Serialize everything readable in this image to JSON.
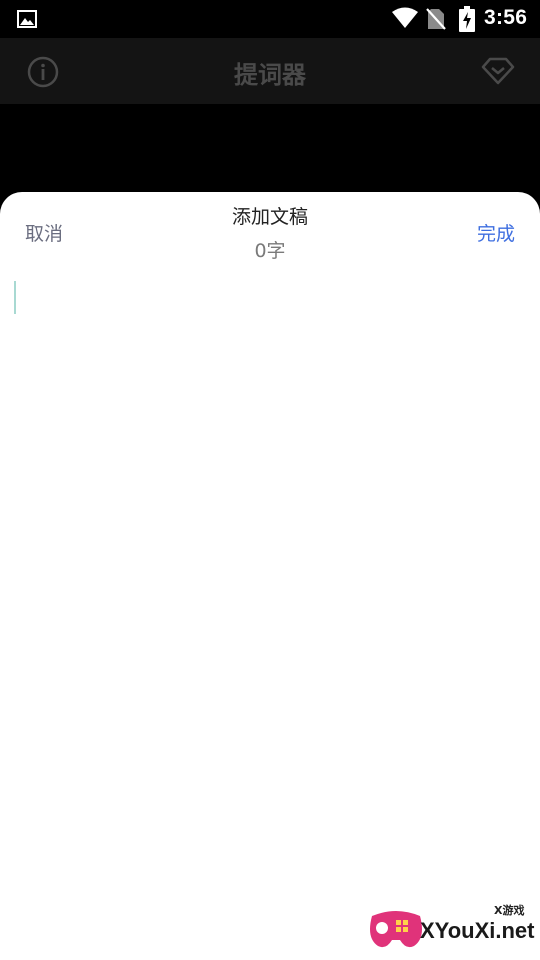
{
  "status_bar": {
    "time": "3:56",
    "icons": [
      "gallery-icon",
      "wifi-icon",
      "no-sim-icon",
      "battery-charging-icon"
    ]
  },
  "app_bar": {
    "title": "提词器",
    "left_icon": "info-icon",
    "right_icon": "diamond-icon"
  },
  "sheet": {
    "title": "添加文稿",
    "word_count": "0字",
    "cancel_label": "取消",
    "done_label": "完成",
    "editor_value": ""
  },
  "watermark": {
    "small_text": "X游戏",
    "text": "XYouXi.net"
  },
  "colors": {
    "background": "#000000",
    "app_bar": "#141414",
    "sheet": "#ffffff",
    "done": "#3f6fe0",
    "cancel": "#6b6e80",
    "caret": "#a8d9d2"
  }
}
